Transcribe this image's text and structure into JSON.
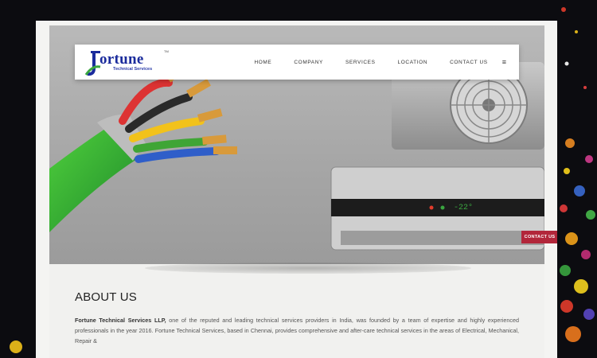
{
  "brand": {
    "logo_initial": "F",
    "logo_name": "ortune",
    "logo_tagline": "Technical Services",
    "logo_tm": "TM"
  },
  "nav": {
    "items": [
      "HOME",
      "COMPANY",
      "SERVICES",
      "LOCATION",
      "CONTACT US"
    ],
    "menu_icon": "hamburger-icon"
  },
  "hero": {
    "ac_display": "-22°"
  },
  "contact_tab": {
    "label": "CONTACT US"
  },
  "about": {
    "title": "ABOUT US",
    "company_name": "Fortune Technical Services LLP,",
    "text_line1": " one of the reputed and leading technical services providers in India, was founded by a team of expertise and highly experienced professionals in the year 2016. Fortune Technical Services, based in Chennai, provides comprehensive and after-care technical services in the areas of Electrical, Mechanical, Repair &"
  },
  "colors": {
    "brand_blue": "#1a2b9c",
    "brand_green": "#3aa640",
    "contact_tab": "#b2263a"
  }
}
